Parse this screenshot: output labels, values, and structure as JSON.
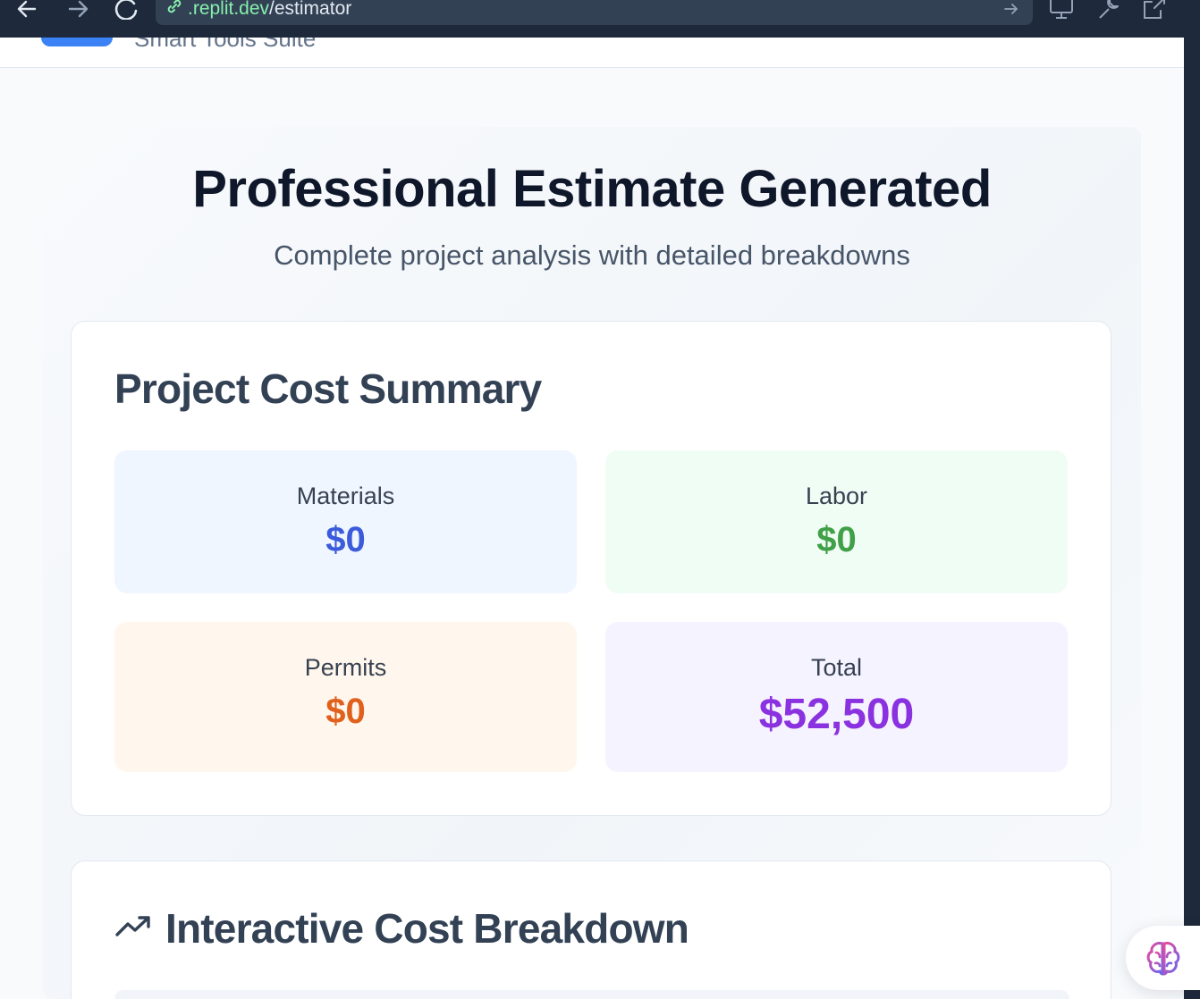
{
  "browser": {
    "back_icon": "arrow-left-icon",
    "forward_icon": "arrow-right-icon",
    "reload_icon": "reload-icon",
    "url_host": ".replit.dev",
    "url_path": "/estimator"
  },
  "header": {
    "app_subtitle": "Smart Tools Suite"
  },
  "page": {
    "title": "Professional Estimate Generated",
    "subtitle": "Complete project analysis with detailed breakdowns"
  },
  "summary": {
    "title": "Project Cost Summary",
    "tiles": [
      {
        "label": "Materials",
        "value": "$0",
        "color": "#3b5bdb"
      },
      {
        "label": "Labor",
        "value": "$0",
        "color": "#40a048"
      },
      {
        "label": "Permits",
        "value": "$0",
        "color": "#e0601c"
      },
      {
        "label": "Total",
        "value": "$52,500",
        "color": "#8b32e0"
      }
    ]
  },
  "breakdown": {
    "title": "Interactive Cost Breakdown",
    "icon": "trending-up-icon"
  },
  "colors": {
    "accent": "#3b82f6",
    "chrome": "#1e293b"
  }
}
